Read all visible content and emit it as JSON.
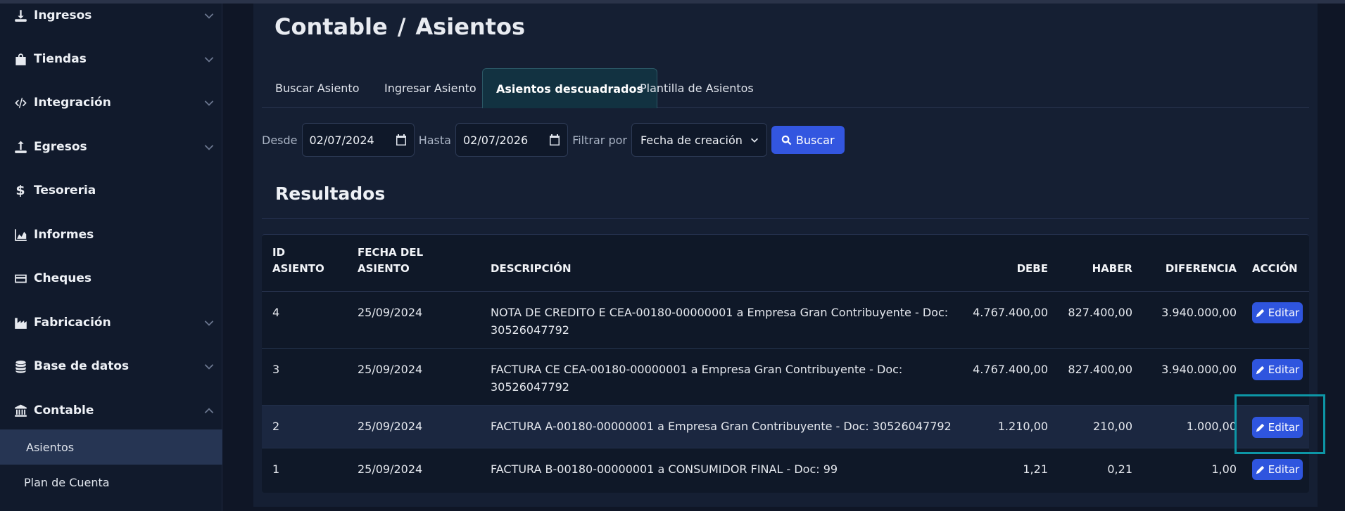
{
  "sidebar": {
    "items": [
      {
        "label": "Ingresos",
        "icon": "download-icon",
        "chevron": "down"
      },
      {
        "label": "Tiendas",
        "icon": "bag-icon",
        "chevron": "down"
      },
      {
        "label": "Integración",
        "icon": "code-icon",
        "chevron": "down"
      },
      {
        "label": "Egresos",
        "icon": "upload-icon",
        "chevron": "down"
      },
      {
        "label": "Tesoreria",
        "icon": "dollar-icon",
        "chevron": ""
      },
      {
        "label": "Informes",
        "icon": "chart-area-icon",
        "chevron": ""
      },
      {
        "label": "Cheques",
        "icon": "card-icon",
        "chevron": ""
      },
      {
        "label": "Fabricación",
        "icon": "industry-icon",
        "chevron": "down"
      },
      {
        "label": "Base de datos",
        "icon": "database-icon",
        "chevron": "down"
      },
      {
        "label": "Contable",
        "icon": "bank-icon",
        "chevron": "up"
      }
    ],
    "subitems": [
      {
        "label": "Asientos",
        "active": true
      },
      {
        "label": "Plan de Cuenta",
        "active": false
      }
    ]
  },
  "breadcrumb": {
    "section": "Contable",
    "separator": "/",
    "page": "Asientos"
  },
  "tabs": [
    {
      "label": "Buscar Asiento",
      "active": false
    },
    {
      "label": "Ingresar Asiento",
      "active": false
    },
    {
      "label": "Asientos descuadrados",
      "active": true
    },
    {
      "label": "Plantilla de Asientos",
      "active": false
    }
  ],
  "filters": {
    "from_label": "Desde",
    "from_value": "02/07/2024",
    "to_label": "Hasta",
    "to_value": "02/07/2026",
    "filter_label": "Filtrar por",
    "filter_value": "Fecha de creación",
    "search_label": "Buscar"
  },
  "results": {
    "title": "Resultados"
  },
  "table": {
    "headers": {
      "id": [
        "ID",
        "ASIENTO"
      ],
      "date": [
        "FECHA DEL",
        "ASIENTO"
      ],
      "description": "DESCRIPCIÓN",
      "debe": "DEBE",
      "haber": "HABER",
      "diferencia": "DIFERENCIA",
      "accion": "ACCIÓN"
    },
    "edit_label": "Editar",
    "rows": [
      {
        "id": "4",
        "date": "25/09/2024",
        "desc1": "NOTA DE CREDITO E CEA-00180-00000001 a Empresa Gran Contribuyente - Doc:",
        "desc2": "30526047792",
        "debe": "4.767.400,00",
        "haber": "827.400,00",
        "diferencia": "3.940.000,00"
      },
      {
        "id": "3",
        "date": "25/09/2024",
        "desc1": "FACTURA CE CEA-00180-00000001 a Empresa Gran Contribuyente - Doc:",
        "desc2": "30526047792",
        "debe": "4.767.400,00",
        "haber": "827.400,00",
        "diferencia": "3.940.000,00"
      },
      {
        "id": "2",
        "date": "25/09/2024",
        "desc1": "FACTURA A-00180-00000001 a Empresa Gran Contribuyente - Doc: 30526047792",
        "desc2": "",
        "debe": "1.210,00",
        "haber": "210,00",
        "diferencia": "1.000,00"
      },
      {
        "id": "1",
        "date": "25/09/2024",
        "desc1": "FACTURA B-00180-00000001 a CONSUMIDOR FINAL - Doc: 99",
        "desc2": "",
        "debe": "1,21",
        "haber": "0,21",
        "diferencia": "1,00"
      }
    ]
  },
  "colors": {
    "accent": "#3356e0",
    "active_tab": "#123241",
    "focus": "#0d96a6"
  }
}
